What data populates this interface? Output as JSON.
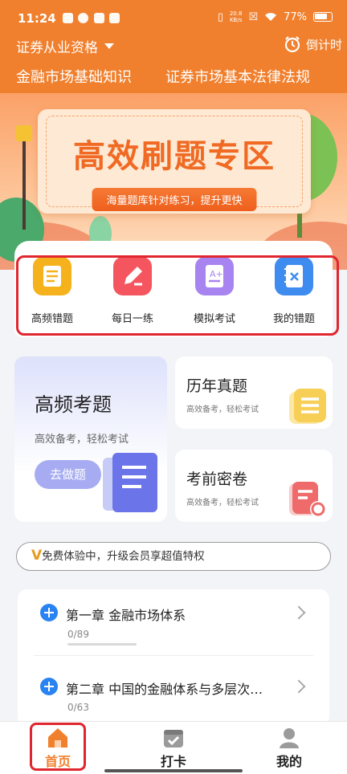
{
  "status_bar": {
    "time": "11:24",
    "net_speed_value": "20.8",
    "net_speed_unit": "KB/s",
    "battery": "77%"
  },
  "header": {
    "subject": "证券从业资格",
    "timer_label": "倒计时",
    "tabs": [
      {
        "label": "金融市场基础知识",
        "active": true
      },
      {
        "label": "证券市场基本法律法规",
        "active": false
      }
    ]
  },
  "banner": {
    "title": "高效刷题专区",
    "subtitle": "海量题库针对练习，提升更快"
  },
  "quick_actions": [
    {
      "label": "高频错题",
      "icon": "checklist-icon",
      "color": "#f6b21c"
    },
    {
      "label": "每日一练",
      "icon": "pencil-icon",
      "color": "#f4555f"
    },
    {
      "label": "模拟考试",
      "icon": "exam-paper-icon",
      "color": "#a884f0"
    },
    {
      "label": "我的错题",
      "icon": "wrong-notebook-icon",
      "color": "#3f8cf0"
    }
  ],
  "cards": {
    "featured": {
      "title": "高频考题",
      "subtitle": "高效备考，轻松考试",
      "button": "去做题"
    },
    "past_exams": {
      "title": "历年真题",
      "subtitle": "高效备考，轻松考试"
    },
    "secret_papers": {
      "title": "考前密卷",
      "subtitle": "高效备考，轻松考试"
    }
  },
  "promo": {
    "badge": "V",
    "text": "免费体验中，升级会员享超值特权"
  },
  "chapters": [
    {
      "title": "第一章 金融市场体系",
      "progress": "0/89"
    },
    {
      "title": "第二章 中国的金融体系与多层次…",
      "progress": "0/63"
    }
  ],
  "bottom_nav": [
    {
      "label": "首页",
      "icon": "home-icon",
      "active": true
    },
    {
      "label": "打卡",
      "icon": "calendar-check-icon",
      "active": false
    },
    {
      "label": "我的",
      "icon": "user-icon",
      "active": false
    }
  ],
  "colors": {
    "brand": "#f0802e",
    "highlight_frame": "#e0262e",
    "accent_blue": "#2a83f2"
  }
}
